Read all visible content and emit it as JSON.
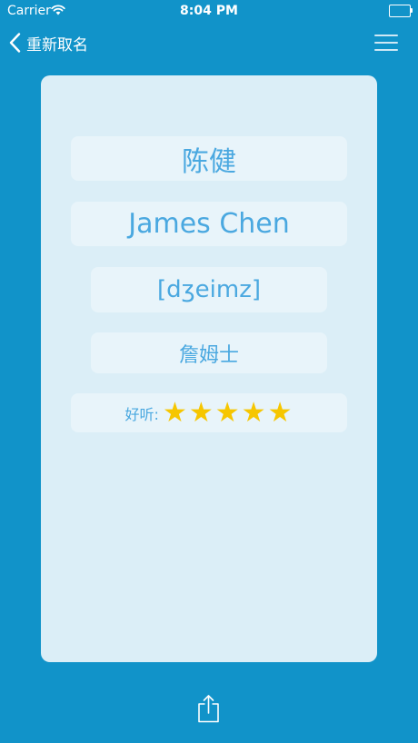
{
  "status_bar": {
    "carrier": "Carrier",
    "time": "8:04 PM"
  },
  "nav": {
    "back_label": "重新取名",
    "back_icon": "chevron-left-icon",
    "menu_icon": "hamburger-menu-icon"
  },
  "result": {
    "chinese_name": "陈健",
    "english_name": "James Chen",
    "phonetic": "[dʒeimz]",
    "transliteration": "詹姆士",
    "rating_label": "好听:",
    "rating_stars": 5,
    "rating_max": 5,
    "star_glyph": "★"
  },
  "toolbar": {
    "share_icon": "share-icon"
  },
  "colors": {
    "background": "#1193c9",
    "card": "#dbeef7",
    "pill": "#e8f4fa",
    "text_accent": "#4aa8e0",
    "star": "#f6c600"
  }
}
